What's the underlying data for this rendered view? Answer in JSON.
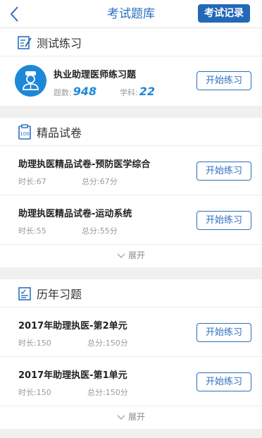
{
  "header": {
    "title": "考试题库",
    "record_label": "考试记录"
  },
  "practice": {
    "title": "测试练习",
    "item": {
      "title": "执业助理医师练习题",
      "count_label": "题数:",
      "count_value": "948",
      "subject_label": "学科:",
      "subject_value": "22",
      "button": "开始练习"
    }
  },
  "papers": {
    "title": "精品试卷",
    "items": [
      {
        "title": "助理执医精品试卷-预防医学综合",
        "duration": "时长:67",
        "score": "总分:67分",
        "button": "开始练习"
      },
      {
        "title": "助理执医精品试卷-运动系统",
        "duration": "时长:55",
        "score": "总分:55分",
        "button": "开始练习"
      }
    ],
    "expand_label": "展开"
  },
  "past": {
    "title": "历年习题",
    "items": [
      {
        "title": "2017年助理执医-第2单元",
        "duration": "时长:150",
        "score": "总分:150分",
        "button": "开始练习"
      },
      {
        "title": "2017年助理执医-第1单元",
        "duration": "时长:150",
        "score": "总分:150分",
        "button": "开始练习"
      }
    ],
    "expand_label": "展开"
  },
  "colors": {
    "accent": "#2c6fbe",
    "button_fill": "#2468b8",
    "highlight": "#1e88d8"
  }
}
